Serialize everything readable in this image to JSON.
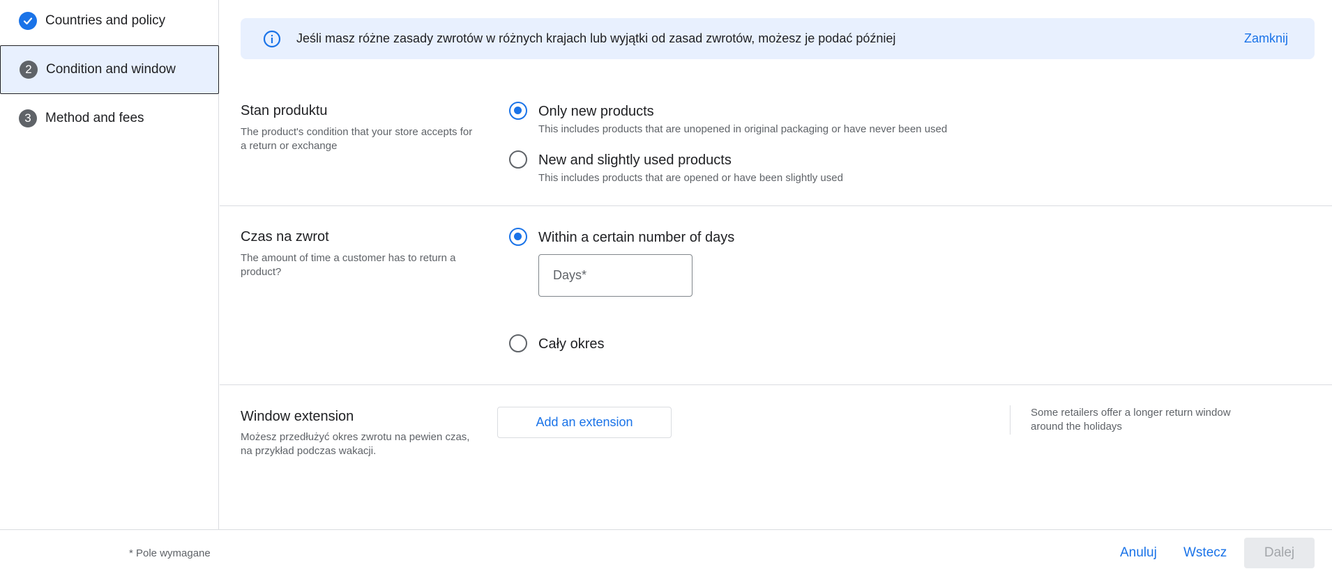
{
  "sidebar": {
    "steps": [
      {
        "number": "",
        "label": "Countries and policy",
        "state": "done"
      },
      {
        "number": "2",
        "label": "Condition and window",
        "state": "active"
      },
      {
        "number": "3",
        "label": "Method and fees",
        "state": "pending"
      }
    ]
  },
  "banner": {
    "icon": "info-icon",
    "message": "Jeśli masz różne zasady zwrotów w różnych krajach lub wyjątki od zasad zwrotów, możesz je podać później",
    "close_label": "Zamknij"
  },
  "condition": {
    "title": "Stan produktu",
    "description": "The product's condition that your store accepts for a return or exchange",
    "options": [
      {
        "label": "Only new products",
        "sublabel": "This includes products that are unopened in original packaging or have never been used",
        "checked": true
      },
      {
        "label": "New and slightly used products",
        "sublabel": "This includes products that are opened or have been slightly used",
        "checked": false
      }
    ]
  },
  "window": {
    "title": "Czas na zwrot",
    "description": "The amount of time a customer has to return a product?",
    "options": [
      {
        "label": "Within a certain number of days",
        "checked": true
      },
      {
        "label": "Cały okres",
        "checked": false
      }
    ],
    "days_input": {
      "value": "",
      "placeholder": "Days*"
    }
  },
  "extension": {
    "title": "Window extension",
    "description": "Możesz przedłużyć okres zwrotu na pewien czas, na przykład podczas wakacji.",
    "button_label": "Add an extension",
    "hint": "Some retailers offer a longer return window around the holidays"
  },
  "footer": {
    "required_note": "* Pole wymagane",
    "cancel_label": "Anuluj",
    "back_label": "Wstecz",
    "next_label": "Dalej"
  },
  "colors": {
    "accent": "#1a73e8",
    "banner_bg": "#e8f0fe",
    "active_step_bg": "#e8f0fe",
    "disabled_button_bg": "#e8eaed"
  }
}
